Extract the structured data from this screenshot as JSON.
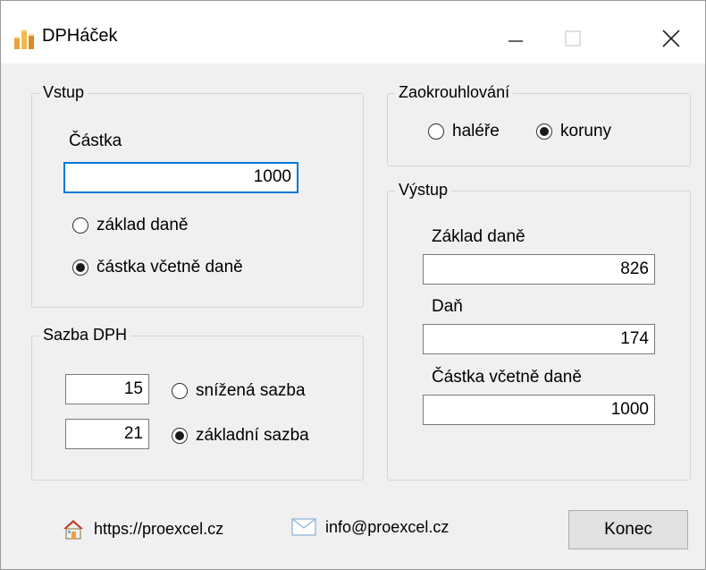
{
  "window": {
    "title": "DPHáček"
  },
  "input_group": {
    "legend": "Vstup",
    "amount_label": "Částka",
    "amount_value": "1000",
    "options": [
      {
        "label": "základ daně",
        "selected": false
      },
      {
        "label": "částka včetně daně",
        "selected": true
      }
    ]
  },
  "vat_group": {
    "legend": "Sazba DPH",
    "rates": [
      {
        "value": "15",
        "label": "snížená sazba",
        "selected": false
      },
      {
        "value": "21",
        "label": "základní sazba",
        "selected": true
      }
    ]
  },
  "rounding_group": {
    "legend": "Zaokrouhlování",
    "options": [
      {
        "label": "haléře",
        "selected": false
      },
      {
        "label": "koruny",
        "selected": true
      }
    ]
  },
  "output_group": {
    "legend": "Výstup",
    "base_label": "Základ daně",
    "base_value": "826",
    "tax_label": "Daň",
    "tax_value": "174",
    "total_label": "Částka včetně daně",
    "total_value": "1000"
  },
  "footer": {
    "website": "https://proexcel.cz",
    "email": "info@proexcel.cz",
    "close_button": "Konec"
  },
  "icons": {
    "app": "coins-icon",
    "website": "home-icon",
    "email": "envelope-icon"
  },
  "colors": {
    "window_bg": "#f0f0f0",
    "focus_border": "#0078d7",
    "app_icon": "#e8a33b"
  }
}
